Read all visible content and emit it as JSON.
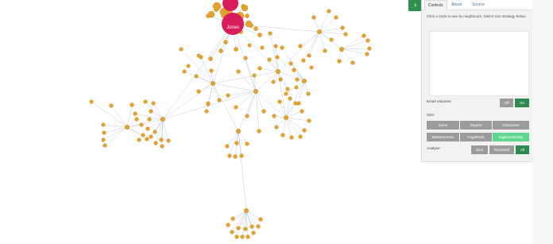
{
  "toggle": {
    "icon": "chevron-right-icon",
    "glyph": "›"
  },
  "tabs": [
    {
      "label": "Controls",
      "active": true
    },
    {
      "label": "About",
      "active": false
    },
    {
      "label": "Source",
      "active": false
    }
  ],
  "instructions": "Click a node to see its neighbours. Select size strategy below.",
  "email_volumes": {
    "label": "Email Volumes:",
    "off": "Off",
    "on": "On",
    "selected": "On"
  },
  "size": {
    "label": "Size:",
    "options": [
      "Same",
      "Degree",
      "Closeness",
      "Betweenness",
      "PageRank",
      "Eigencentrality"
    ],
    "selected": "Eigencentrality"
  },
  "analyse": {
    "label": "Analyse:",
    "options": [
      "Sent",
      "Received",
      "All"
    ],
    "selected": "All"
  },
  "graph": {
    "highlight_labels": [
      "Jones"
    ],
    "colors": {
      "node": "#e3a230",
      "highlight": "#d91c5c",
      "edge": "#9fb3c8",
      "accent": "#2e8b4f",
      "active": "#5fd88d"
    }
  }
}
